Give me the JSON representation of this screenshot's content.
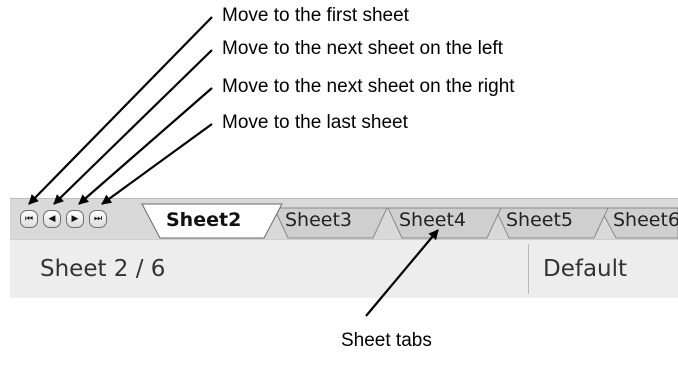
{
  "callouts": {
    "first": "Move to the first sheet",
    "prev": "Move to the next sheet on the left",
    "next": "Move to the next sheet on the right",
    "last": "Move to the last sheet",
    "tabs": "Sheet tabs"
  },
  "nav_buttons": {
    "first": {
      "icon": "first-sheet-icon",
      "glyph": "⏮"
    },
    "prev": {
      "icon": "previous-sheet-icon",
      "glyph": "◀"
    },
    "next": {
      "icon": "next-sheet-icon",
      "glyph": "▶"
    },
    "last": {
      "icon": "last-sheet-icon",
      "glyph": "⏭"
    }
  },
  "tabs": [
    {
      "label": "Sheet2",
      "active": true
    },
    {
      "label": "Sheet3",
      "active": false
    },
    {
      "label": "Sheet4",
      "active": false
    },
    {
      "label": "Sheet5",
      "active": false
    },
    {
      "label": "Sheet6",
      "active": false
    }
  ],
  "status": {
    "sheet": "Sheet 2 / 6",
    "page_style": "Default"
  },
  "colors": {
    "tab_bar": "#d9d9d9",
    "active_tab": "#ffffff",
    "inactive_tab": "#cfcfcf",
    "status_bar": "#ededed"
  }
}
